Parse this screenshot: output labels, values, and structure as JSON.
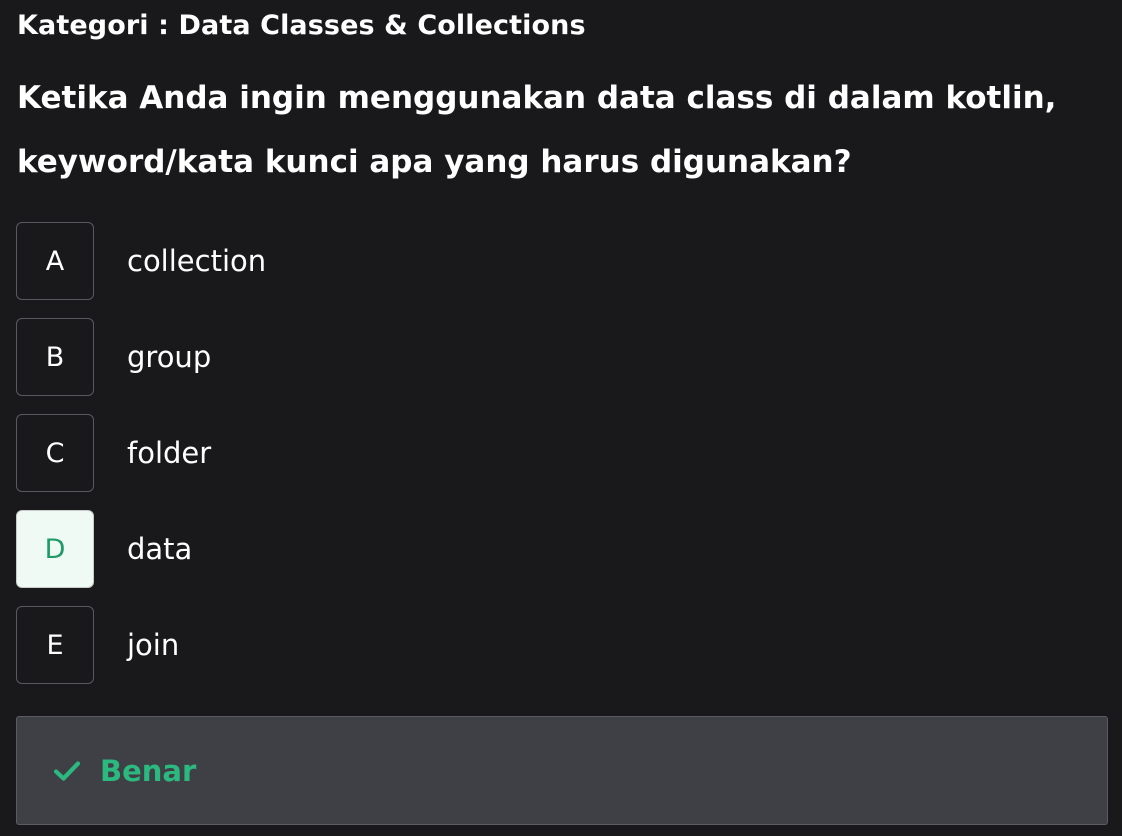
{
  "category": "Kategori : Data Classes & Collections",
  "question": "Ketika Anda ingin menggunakan data class di dalam kotlin, keyword/kata kunci apa yang harus digunakan?",
  "options": [
    {
      "letter": "A",
      "text": "collection",
      "selected": false
    },
    {
      "letter": "B",
      "text": "group",
      "selected": false
    },
    {
      "letter": "C",
      "text": "folder",
      "selected": false
    },
    {
      "letter": "D",
      "text": "data",
      "selected": true
    },
    {
      "letter": "E",
      "text": "join",
      "selected": false
    }
  ],
  "feedback": {
    "icon": "check-icon",
    "label": "Benar",
    "color": "#2bb980"
  },
  "colors": {
    "background": "#19191b",
    "selected_bg": "#eefaf3",
    "selected_text": "#1e9b67",
    "feedback_bg": "#3f4045",
    "accent": "#2bb980"
  }
}
